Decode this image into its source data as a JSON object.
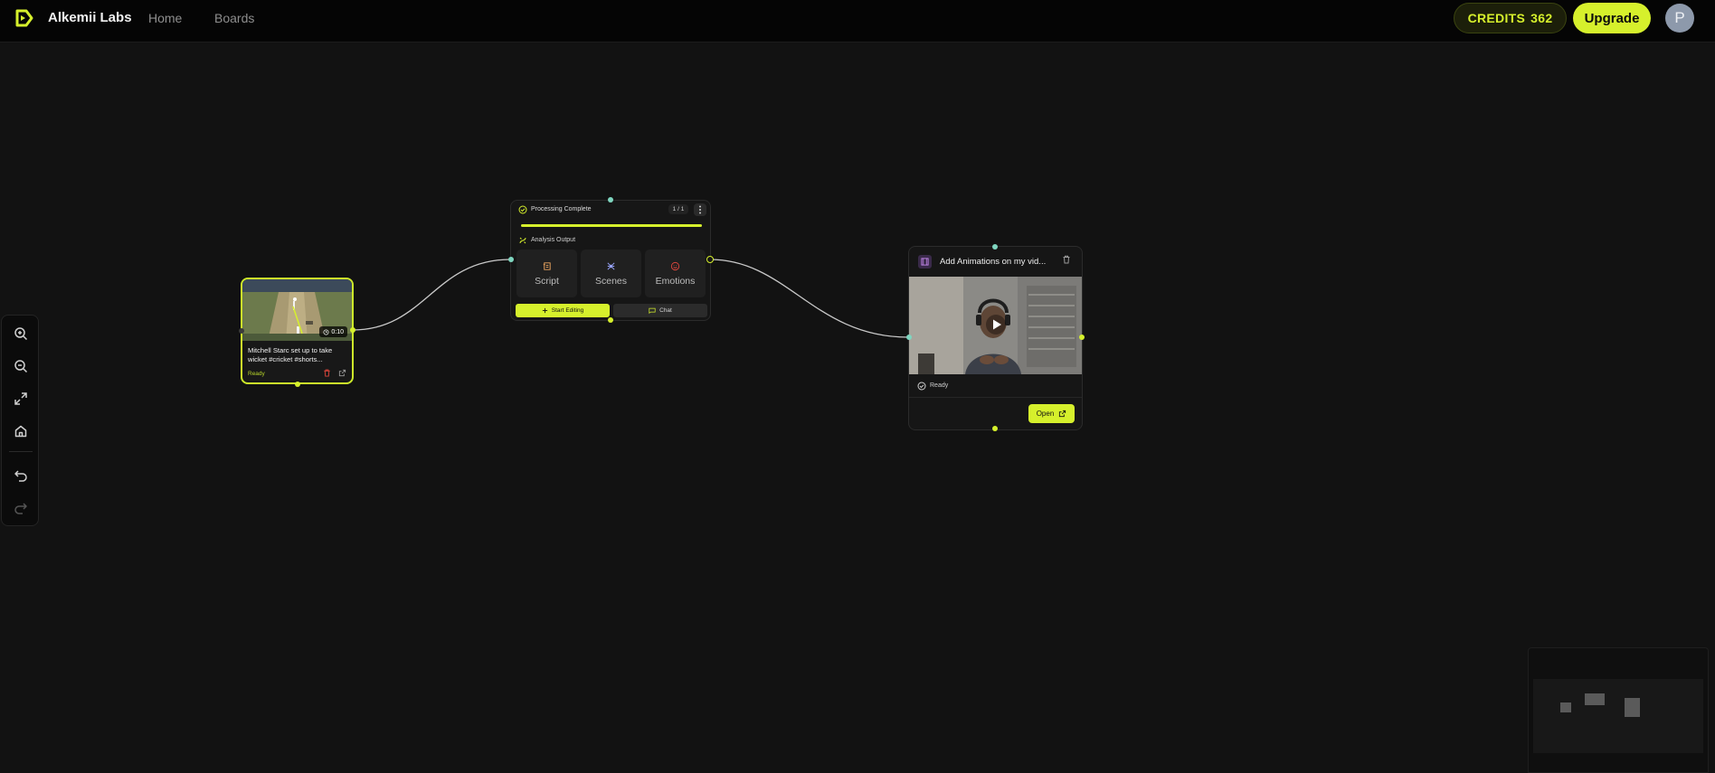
{
  "header": {
    "brand": "Alkemii Labs",
    "nav": [
      "Home",
      "Boards"
    ],
    "credits_label": "CREDITS",
    "credits_value": "362",
    "upgrade_label": "Upgrade",
    "avatar_initial": "P"
  },
  "toolbar": {
    "buttons": [
      "zoom-in-icon",
      "zoom-out-icon",
      "fit-view-icon",
      "home-icon",
      "undo-icon",
      "redo-icon"
    ]
  },
  "video_node": {
    "duration": "0:10",
    "title": "Mitchell Starc set up to take wicket #cricket #shorts...",
    "status": "Ready"
  },
  "processing_node": {
    "title": "Processing Complete",
    "count": "1 / 1",
    "progress": 1.0,
    "section_label": "Analysis Output",
    "tiles": [
      "Script",
      "Scenes",
      "Emotions"
    ],
    "start_editing_label": "Start Editing",
    "chat_label": "Chat"
  },
  "output_node": {
    "title": "Add Animations on my vid...",
    "status": "Ready",
    "open_label": "Open"
  },
  "colors": {
    "accent": "#d6f02c",
    "background": "#121212",
    "topbar": "#050505",
    "delete": "#e0463c"
  }
}
